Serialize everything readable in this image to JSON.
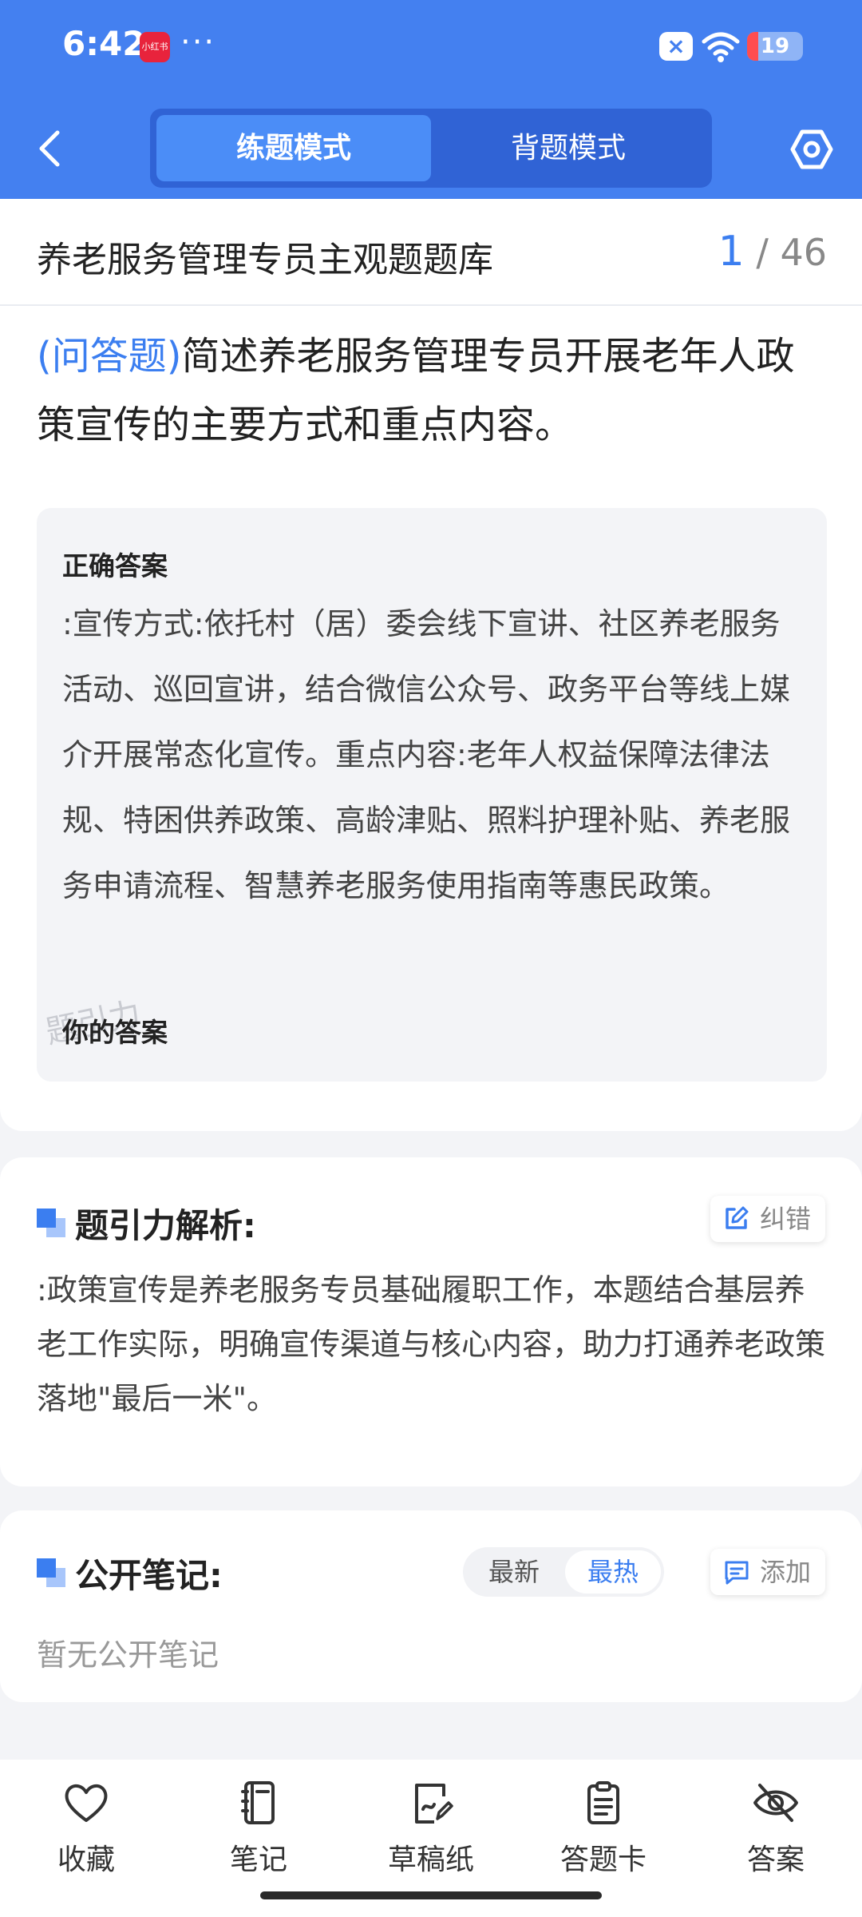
{
  "status_bar": {
    "time": "6:42",
    "app_badge": "小红书",
    "more": "···",
    "battery": "19"
  },
  "header": {
    "modes": [
      "练题模式",
      "背题模式"
    ],
    "active_mode": "练题模式",
    "accent_color": "#4480f0"
  },
  "title_bar": {
    "title": "养老服务管理专员主观题题库",
    "current": "1",
    "total": "/ 46"
  },
  "question": {
    "type": "(问答题)",
    "text": "简述养老服务管理专员开展老年人政策宣传的主要方式和重点内容。"
  },
  "answer": {
    "heading": "正确答案",
    "text": ":宣传方式:依托村（居）委会线下宣讲、社区养老服务活动、巡回宣讲，结合微信公众号、政务平台等线上媒介开展常态化宣传。重点内容:老年人权益保障法律法规、特困供养政策、高龄津贴、照料护理补贴、养老服务申请流程、智慧养老服务使用指南等惠民政策。",
    "your_answer_label": "你的答案",
    "watermark": "题引力"
  },
  "analysis": {
    "title": "题引力解析:",
    "report_label": "纠错",
    "text": ":政策宣传是养老服务专员基础履职工作，本题结合基层养老工作实际，明确宣传渠道与核心内容，助力打通养老政策落地\"最后一米\"。"
  },
  "notes": {
    "title": "公开笔记:",
    "sort_latest": "最新",
    "sort_hot": "最热",
    "add_label": "添加",
    "empty_text": "暂无公开笔记"
  },
  "bottom_nav": {
    "favorite": "收藏",
    "notes": "笔记",
    "scratch": "草稿纸",
    "answer_card": "答题卡",
    "answer": "答案"
  }
}
